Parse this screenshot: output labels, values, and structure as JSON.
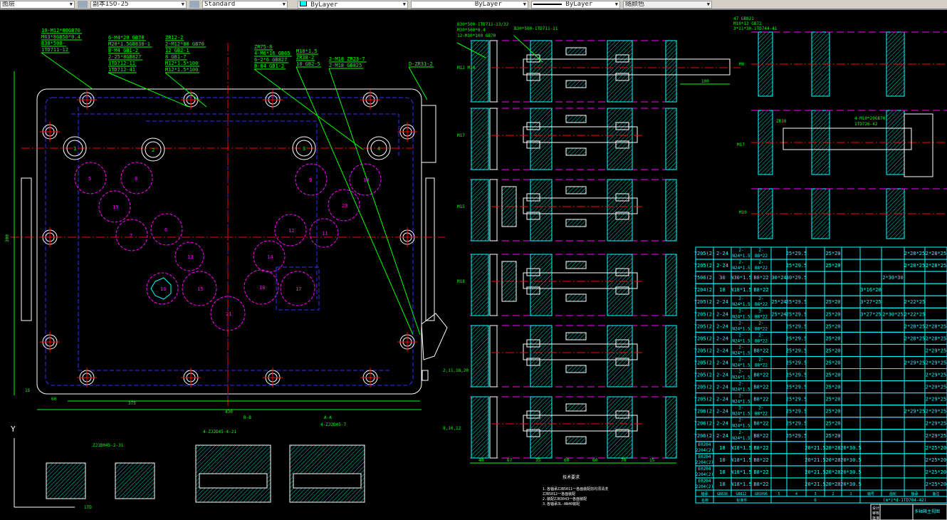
{
  "toolbar": {
    "layer_combo": "图层",
    "dimstyle_combo": "副本ISO-25",
    "textstyle_combo": "Standard",
    "color_combo": "ByLayer",
    "linetype_combo": "ByLayer",
    "lineweight_combo": "ByLayer",
    "plotstyle_combo": "随颜色"
  },
  "colors": {
    "green": "#00ff00",
    "cyan": "#00ffff",
    "magenta": "#ff00ff",
    "red": "#ff0000",
    "white": "#ffffff",
    "blue": "#3030ff"
  },
  "plan": {
    "leaders": [
      {
        "lines": [
          "10-M12*80GB70",
          "M63*8GB50*0.4",
          "B30*500-",
          "1TD711-12"
        ]
      },
      {
        "lines": [
          "6-M4*20 GB70",
          "M20*1.5GB838-1",
          "B-M4 GB1-2",
          "2-25*8GB827",
          "1TD712-11",
          "1TD712-41"
        ]
      },
      {
        "lines": [
          "ZR12-2",
          "2-M12*80 GB70",
          "12 GB2-1",
          "8 GB1-7",
          "M12*1.5*100",
          "M12*1.5*100"
        ]
      },
      {
        "lines": [
          "ZR75-8",
          "4-M6*16 GB65",
          "6-2*6 GB827",
          "B-84 GB1-2"
        ]
      },
      {
        "lines": [
          "M18*1.5",
          "ZR38-2",
          "18 GB2-5"
        ]
      },
      {
        "lines": [
          "2-M18 ZR23-7",
          "2-M18 GB825"
        ]
      },
      {
        "lines": [
          "D-ZR31-2"
        ]
      }
    ],
    "gears": [
      "5",
      "8",
      "19",
      "7",
      "6",
      "13",
      "9",
      "10",
      "20",
      "12",
      "11",
      "14",
      "15",
      "16",
      "18",
      "17",
      "21"
    ],
    "shaft_nums": [
      "1",
      "2",
      "3",
      "4"
    ],
    "dims": {
      "width_total": "430",
      "width_inner": "375",
      "height": "300",
      "left_a": "60",
      "left_b": "15"
    }
  },
  "sections": {
    "leaders": [
      {
        "lines": [
          "B30*500-1TD711-13/32",
          "M30*500*0.4",
          "12-M10*100 GB70"
        ]
      },
      {
        "lines": [
          "B30*500-1TD711-11"
        ]
      }
    ],
    "labels": [
      "M12 M14",
      "M17",
      "M15",
      "M18",
      "",
      ""
    ],
    "dim_100": "100",
    "note_side": [
      "2,11,18,20",
      "8,10,12"
    ],
    "bottom_dims": [
      "40",
      "67",
      "35",
      "60",
      "60",
      "70",
      "15"
    ]
  },
  "right_detail": {
    "leader": [
      "47 GB821",
      "M10*12 GB72",
      "3*21*30-1TD744-41"
    ],
    "labels": [
      "M0",
      "ZR10",
      "M17",
      "4-M10*20GB70",
      "1TD726-42",
      "M10"
    ]
  },
  "views": {
    "section_b": "B-B",
    "section_a": "A-A",
    "axis_y": "Y",
    "detail_labels": [
      "ZJ1B045-2-31",
      "4-ZJ2D45-4-21",
      "4-ZJ2D45-7",
      "1TD"
    ]
  },
  "notes": {
    "title": "技术要求",
    "lines": [
      "1.各轴承ZJB5011一各面装配前均须清洗",
      "ZJB5012一各面装配",
      "2.装配ZJB3043一各面装配",
      "3.各轴承3L-AN40装配"
    ]
  },
  "table": {
    "rows": [
      [
        "7205(2)",
        "2-24",
        "2-\nN24*1.5",
        "2-\nB8*22",
        "",
        "25*29.5",
        "",
        "25*20",
        "",
        "",
        "",
        "2*28*25",
        "2*28*25"
      ],
      [
        "7205(2)",
        "2-24",
        "2-\nN24*1.5",
        "2-\nB8*22",
        "",
        "25*29.5",
        "",
        "25*20",
        "",
        "",
        "",
        "2*28*25",
        "2*28*25"
      ],
      [
        "7506(2)",
        "30",
        "N30*1.5",
        "B8*22",
        "30*24",
        "30*29.5",
        "",
        "",
        "",
        "",
        "2*30*30",
        "",
        ""
      ],
      [
        "7204(2)",
        "18",
        "N18*1.5",
        "B8*22",
        "",
        "",
        "",
        "",
        "",
        "3*16*20",
        "",
        "",
        ""
      ],
      [
        "7205(2)",
        "2-24",
        "2-\nN24*1.5",
        "2-\nB8*22",
        "25*24",
        "25*29.5",
        "",
        "25*20",
        "",
        "3*27*25",
        "",
        "2*22*25",
        ""
      ],
      [
        "7205(2)",
        "2-24",
        "2-\nN24*1.5",
        "3-\nB8*22",
        "25*24",
        "25*29.5",
        "",
        "25*20",
        "",
        "3*27*25",
        "2*30*25",
        "2*22*25",
        ""
      ],
      [
        "7205(2)",
        "2-24",
        "2-\nN24*1.5",
        "2-\nB8*22",
        "",
        "25*29.5",
        "",
        "25*20",
        "",
        "",
        "",
        "2*28*25",
        "2*28*25"
      ],
      [
        "7205(2)",
        "2-24",
        "2-\nN24*1.5",
        "2-\nB8*22",
        "",
        "25*29.5",
        "",
        "25*20",
        "",
        "",
        "",
        "2*28*25",
        "2*28*25"
      ],
      [
        "7205(2)",
        "2-24",
        "2-\nN24*1.5",
        "B8*22",
        "",
        "25*29.5",
        "",
        "25*20",
        "",
        "",
        "",
        "",
        "2*29*25"
      ],
      [
        "7205(2)",
        "2-24",
        "2-\nN24*1.5",
        "2-\nB8*22",
        "",
        "25*29.5",
        "",
        "25*20",
        "",
        "",
        "",
        "2*29*25",
        "2*29*25"
      ],
      [
        "7205(2)",
        "2-24",
        "2-\nN24*1.5",
        "B8*22",
        "",
        "25*29.5",
        "",
        "25*20",
        "",
        "",
        "",
        "",
        "2*29*25"
      ],
      [
        "7205(2)",
        "2-24",
        "2-\nN24*1.5",
        "B8*22",
        "",
        "25*29.5",
        "",
        "25*20",
        "",
        "",
        "",
        "",
        "2*29*25"
      ],
      [
        "7205(2)",
        "2-24",
        "2-\nN24*1.5",
        "B8*22",
        "",
        "25*29.5",
        "",
        "25*20",
        "",
        "",
        "",
        "",
        "2*29*25"
      ],
      [
        "7206(2)",
        "2-24",
        "2-\nN24*1.5",
        "2-\nB8*22",
        "",
        "25*29.5",
        "",
        "25*20",
        "",
        "",
        "",
        "2*29*25",
        "2*29*25"
      ],
      [
        "7206(2)",
        "2-24",
        "2-\nN24*1.5",
        "B8*22",
        "",
        "25*29.5",
        "",
        "25*20",
        "",
        "",
        "",
        "",
        "2*29*25"
      ],
      [
        "7206(2)",
        "2-24",
        "2-\nN24*1.5",
        "B8*22",
        "",
        "25*29.5",
        "",
        "25*20",
        "",
        "",
        "",
        "",
        "2*29*25"
      ],
      [
        "E0204\n2204(2)",
        "18",
        "N18*1.5",
        "B8*22",
        "",
        "",
        "20*21.5",
        "20*28",
        "20*30.5",
        "",
        "",
        "",
        "2*25*20"
      ],
      [
        "E0204\n2204(2)",
        "18",
        "N18*1.5",
        "B8*22",
        "",
        "",
        "20*21.5",
        "20*28",
        "20*30.5",
        "",
        "",
        "",
        "2*25*20"
      ],
      [
        "E0204\n2204(2)",
        "18",
        "N18*1.5",
        "B8*22",
        "",
        "",
        "20*21.5",
        "20*28",
        "20*30.5",
        "",
        "",
        "",
        "2*25*20"
      ],
      [
        "E0204\n2204(2)",
        "18",
        "N18*1.5",
        "B8*22",
        "",
        "",
        "20*21.5",
        "20*28",
        "20*30.5",
        "",
        "",
        "",
        "2*25*20"
      ]
    ],
    "header": [
      "轴承",
      "GB838\n螺母",
      "GB812\n垫圈",
      "GB1096\n键",
      "5",
      "4",
      "3",
      "2",
      "1",
      "轴号",
      "齿轮",
      "轴承",
      "备注"
    ],
    "footer": [
      "名称",
      "标准件",
      "6",
      "(m*z*d-1TD704-42)"
    ],
    "title_block": [
      "设计",
      "审核",
      "批准",
      "多轴箱主视图"
    ]
  }
}
